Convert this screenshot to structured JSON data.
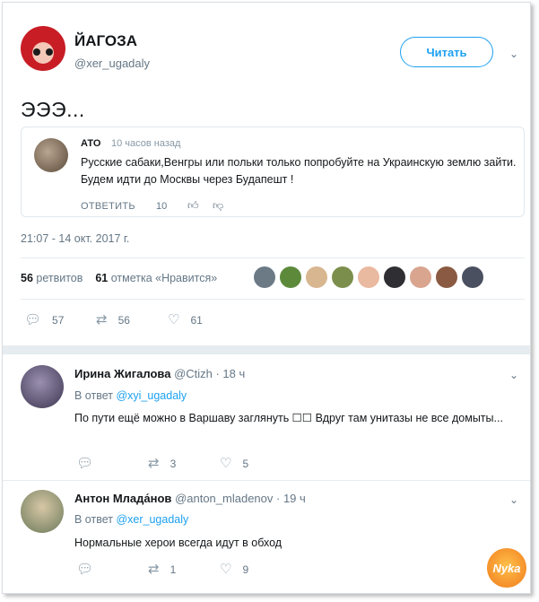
{
  "main_tweet": {
    "author_name": "ЙАГОЗА",
    "author_handle": "@xer_ugadaly",
    "follow_label": "Читать",
    "text": "ЭЭЭ...",
    "timestamp": "21:07 - 14 окт. 2017 г.",
    "quote": {
      "author": "АТО",
      "time": "10 часов назад",
      "text": "Русские сабаки,Венгры или польки только попробуйте на Украинскую землю зайти. Будем идти до Москвы через Будапешт !",
      "reply_label": "ОТВЕТИТЬ",
      "like_count": "10"
    },
    "retweets_count": "56",
    "retweets_label": "ретвитов",
    "likes_count": "61",
    "likes_label": "отметка «Нравится»",
    "actions": {
      "replies": "57",
      "retweets": "56",
      "likes": "61"
    }
  },
  "replies": [
    {
      "name": "Ирина Жигалова",
      "handle": "@Ctizh · 18 ч",
      "reply_to_prefix": "В ответ",
      "reply_to": "@xyi_ugadaly",
      "text": "По пути ещё можно в Варшаву заглянуть ☐☐ Вдруг там унитазы не все домыты...",
      "counts": {
        "replies": "",
        "retweets": "3",
        "likes": "5"
      }
    },
    {
      "name": "Антон Млада́нов",
      "handle": "@anton_mladenov · 19 ч",
      "reply_to_prefix": "В ответ",
      "reply_to": "@xer_ugadaly",
      "text": "Нормальные херои всегда идут в обход",
      "counts": {
        "replies": "",
        "retweets": "1",
        "likes": "9"
      }
    }
  ],
  "watermark": "Nyka",
  "colors": {
    "accent": "#1da1f2",
    "muted": "#657786",
    "border": "#e1e8ed"
  }
}
